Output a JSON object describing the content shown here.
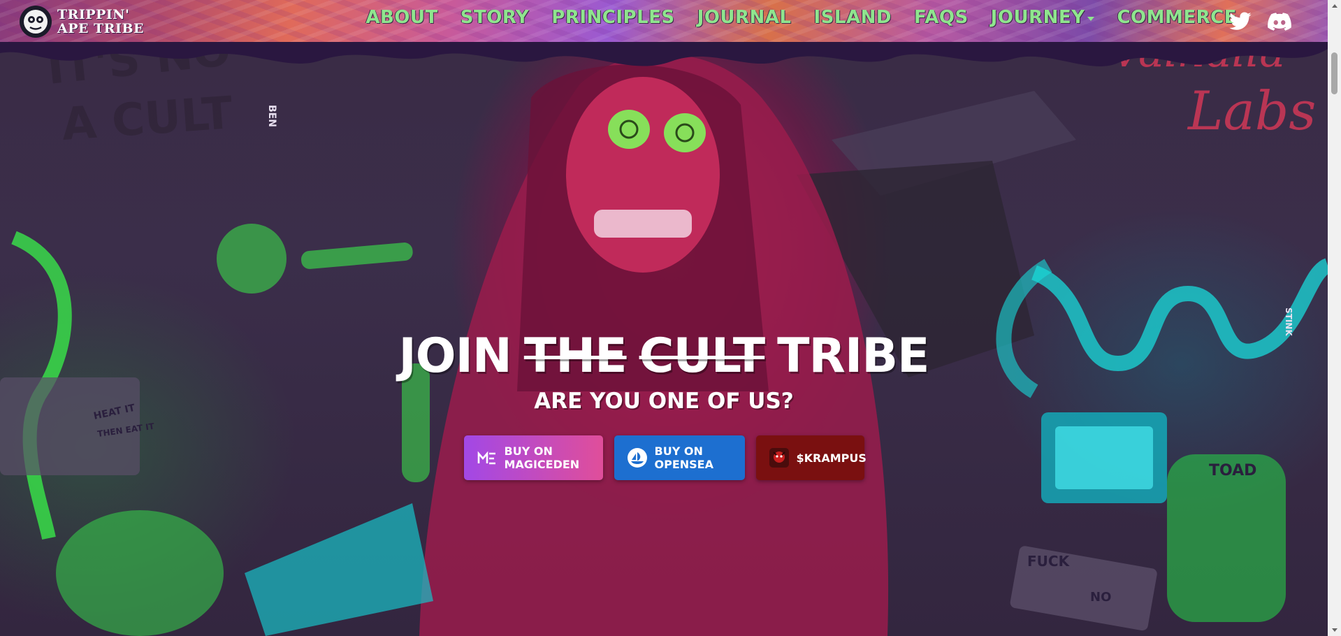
{
  "brand": {
    "line1": "TRIPPIN'",
    "line2": "APE TRIBE"
  },
  "nav": {
    "items": [
      {
        "label": "ABOUT"
      },
      {
        "label": "STORY"
      },
      {
        "label": "PRINCIPLES"
      },
      {
        "label": "JOURNAL"
      },
      {
        "label": "ISLAND"
      },
      {
        "label": "FAQS"
      },
      {
        "label": "JOURNEY"
      },
      {
        "label": "COMMERCE"
      }
    ],
    "social": [
      "twitter-icon",
      "discord-icon"
    ]
  },
  "hero": {
    "title_word1": "JOIN",
    "title_word2": "THE",
    "title_word3": "CULT",
    "title_word4": "TRIBE",
    "subtitle": "ARE YOU ONE OF US?"
  },
  "buttons": {
    "magiceden": "BUY ON MAGICEDEN",
    "opensea": "BUY ON OPENSEA",
    "krampus": "$KRAMPUS"
  },
  "colors": {
    "nav_text": "#8fe58e",
    "magiceden_start": "#a248e6",
    "magiceden_end": "#e04e9a",
    "opensea": "#1d6fd0",
    "krampus": "#7a1010"
  },
  "scene_texts": {
    "board_1": "IT'S NO",
    "board_2": "A CULT",
    "neon": "Valhalla",
    "neon_2": "Labs",
    "tag_1": "BEN",
    "tag_2": "STINK",
    "jar": "TOAD",
    "keyboard_1": "FUCK",
    "keyboard_2": "NO",
    "box_1": "HEAT IT",
    "box_2": "THEN EAT IT"
  }
}
